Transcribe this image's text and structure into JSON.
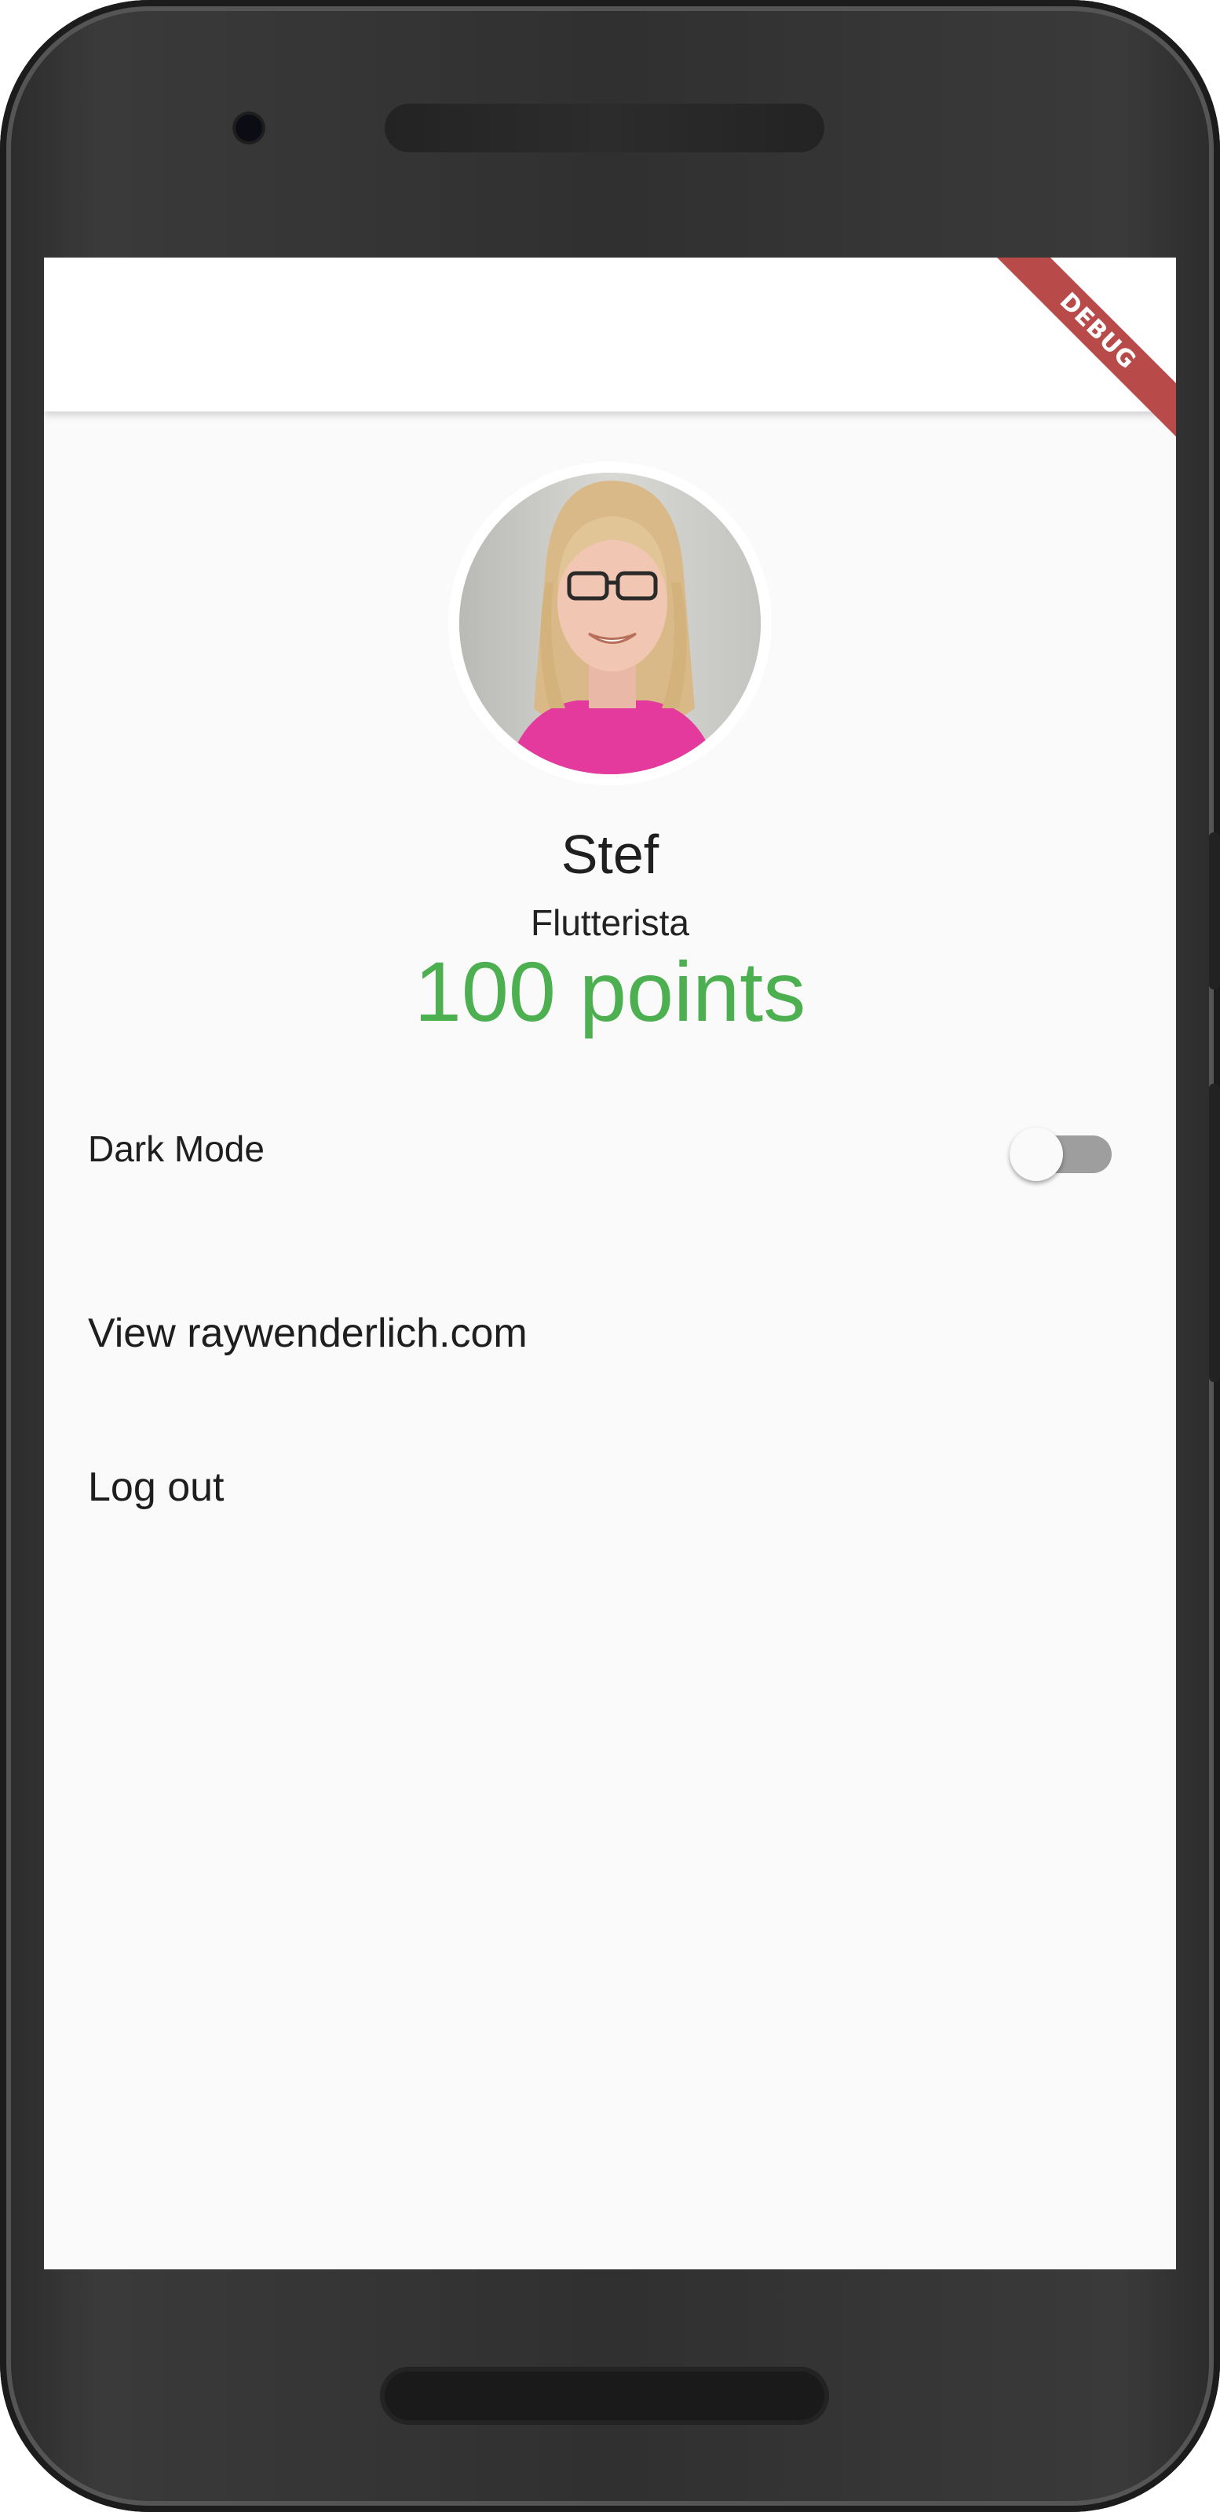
{
  "debug_banner": "DEBUG",
  "profile": {
    "name": "Stef",
    "role": "Flutterista",
    "points": "100 points"
  },
  "settings": {
    "dark_mode_label": "Dark Mode",
    "dark_mode_enabled": false
  },
  "links": {
    "view_site": "View raywenderlich.com",
    "logout": "Log out"
  },
  "colors": {
    "points": "#4caf50",
    "debug_banner": "#b84a4a",
    "background": "#fafafa"
  }
}
